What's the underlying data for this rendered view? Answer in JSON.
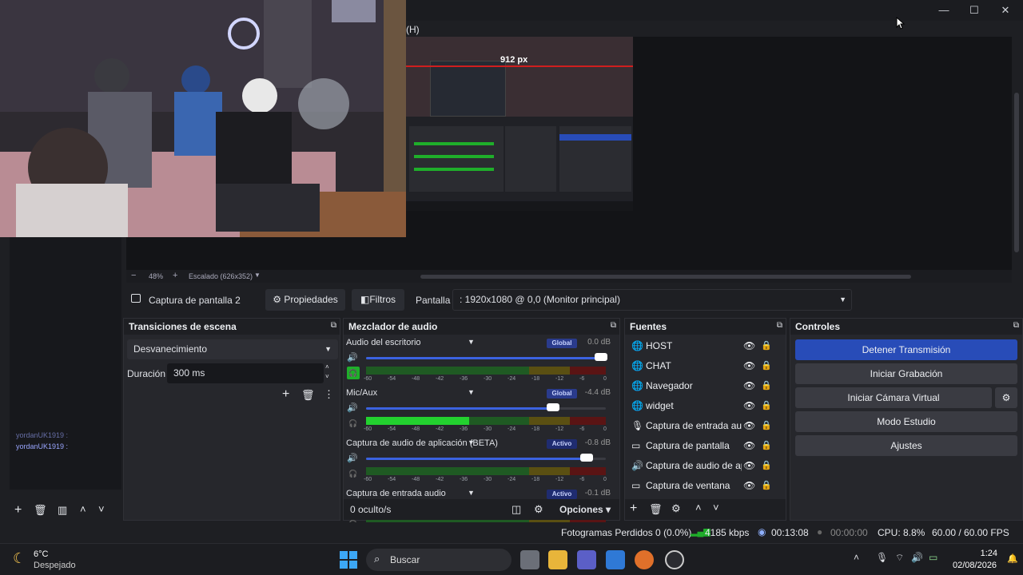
{
  "window": {
    "menu_h": "(H)",
    "minimize": "—",
    "maximize": "☐",
    "close": "✕"
  },
  "preview": {
    "nested_label": "912 px",
    "zoom": "48%",
    "scale_label": "Escalado (626x352)"
  },
  "context_bar": {
    "source_name": "Captura de pantalla 2",
    "properties": "Propiedades",
    "filters": "Filtros",
    "display_label": "Pantalla",
    "display_value": ": 1920x1080 @ 0,0 (Monitor principal)"
  },
  "transitions": {
    "title": "Transiciones de escena",
    "selected": "Desvanecimiento",
    "duration_label": "Duración",
    "duration_value": "300 ms"
  },
  "mixer": {
    "title": "Mezclador de audio",
    "channels": [
      {
        "name": "Audio del escritorio",
        "badge": "Global",
        "db": "0.0 dB",
        "volume": 1.0
      },
      {
        "name": "Mic/Aux",
        "badge": "Global",
        "db": "-4.4 dB",
        "volume": 0.8
      },
      {
        "name": "Captura de audio de aplicación (BETA)",
        "badge": "Activo",
        "db": "-0.8 dB",
        "volume": 0.94
      },
      {
        "name": "Captura de entrada audio",
        "badge": "Activo",
        "db": "-0.1 dB",
        "volume": 1.0
      }
    ],
    "scale": [
      "-60",
      "-54",
      "-48",
      "-42",
      "-36",
      "-30",
      "-24",
      "-18",
      "-12",
      "-6",
      "0"
    ],
    "hidden": "0 oculto/s",
    "options": "Opciones"
  },
  "sources": {
    "title": "Fuentes",
    "items": [
      "HOST",
      "CHAT",
      "Navegador",
      "widget",
      "Captura de entrada auc",
      "Captura de pantalla",
      "Captura de audio de ap",
      "Captura de ventana"
    ]
  },
  "controls": {
    "title": "Controles",
    "stop_stream": "Detener Transmisión",
    "start_recording": "Iniciar Grabación",
    "virtual_cam": "Iniciar Cámara Virtual",
    "studio_mode": "Modo Estudio",
    "settings": "Ajustes"
  },
  "chat": {
    "lines": [
      "yordanUK1919 :",
      "yordanUK1919 :"
    ]
  },
  "status": {
    "dropped": "Fotogramas Perdidos 0 (0.0%)",
    "bitrate": "4185 kbps",
    "stream_time": "00:13:08",
    "rec_time": "00:00:00",
    "cpu": "CPU: 8.8%",
    "fps": "60.00 / 60.00 FPS"
  },
  "taskbar": {
    "temp": "6°C",
    "weather": "Despejado",
    "search": "Buscar",
    "time": "1:24",
    "date": "02/08/2026"
  },
  "colors": {
    "accent": "#284cb8",
    "meter_green": "#1fae2a",
    "meter_yellow": "#a89a1a",
    "meter_red": "#a11d1d"
  }
}
